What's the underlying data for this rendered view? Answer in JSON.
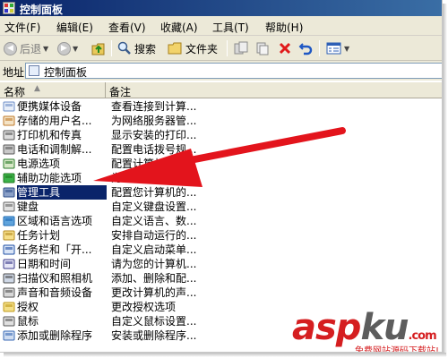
{
  "window": {
    "title": "控制面板"
  },
  "menu": [
    "文件(F)",
    "编辑(E)",
    "查看(V)",
    "收藏(A)",
    "工具(T)",
    "帮助(H)"
  ],
  "toolbar": {
    "back_label": "后退",
    "search_label": "搜索",
    "folders_label": "文件夹"
  },
  "address": {
    "label": "地址(D)",
    "value": "控制面板"
  },
  "columns": {
    "name": "名称",
    "desc": "备注"
  },
  "items": [
    {
      "name": "便携媒体设备",
      "desc": "查看连接到计算...",
      "icon": "media-device-icon"
    },
    {
      "name": "存储的用户名...",
      "desc": "为网络服务器管...",
      "icon": "stored-users-icon"
    },
    {
      "name": "打印机和传真",
      "desc": "显示安装的打印...",
      "icon": "printer-icon"
    },
    {
      "name": "电话和调制解...",
      "desc": "配置电话拨号规...",
      "icon": "phone-icon"
    },
    {
      "name": "电源选项",
      "desc": "配置计算机...",
      "icon": "power-icon"
    },
    {
      "name": "辅助功能选项",
      "desc": "为...",
      "icon": "accessibility-icon"
    },
    {
      "name": "管理工具",
      "desc": "配置您计算机的...",
      "icon": "admin-tools-icon",
      "selected": true
    },
    {
      "name": "键盘",
      "desc": "自定义键盘设置...",
      "icon": "keyboard-icon"
    },
    {
      "name": "区域和语言选项",
      "desc": "自定义语言、数...",
      "icon": "region-icon"
    },
    {
      "name": "任务计划",
      "desc": "安排自动运行的...",
      "icon": "task-schedule-icon"
    },
    {
      "name": "任务栏和「开...",
      "desc": "自定义启动菜单...",
      "icon": "taskbar-icon"
    },
    {
      "name": "日期和时间",
      "desc": "请为您的计算机...",
      "icon": "datetime-icon"
    },
    {
      "name": "扫描仪和照相机",
      "desc": "添加、删除和配...",
      "icon": "scanner-icon"
    },
    {
      "name": "声音和音频设备",
      "desc": "更改计算机的声...",
      "icon": "sound-icon"
    },
    {
      "name": "授权",
      "desc": "更改授权选项",
      "icon": "license-icon"
    },
    {
      "name": "鼠标",
      "desc": "自定义鼠标设置...",
      "icon": "mouse-icon"
    },
    {
      "name": "添加或删除程序",
      "desc": "安装或删除程序...",
      "icon": "add-remove-icon"
    }
  ],
  "watermark": {
    "brand": "aspku",
    "brand_a": "asp",
    "brand_b": "ku",
    "suffix": ".com",
    "slogan": "免费网站源码下载站!"
  },
  "colors": {
    "title_bar": "#0a246a",
    "selection": "#0a246a",
    "arrow": "#e3141c",
    "watermark": "#d51e20"
  }
}
